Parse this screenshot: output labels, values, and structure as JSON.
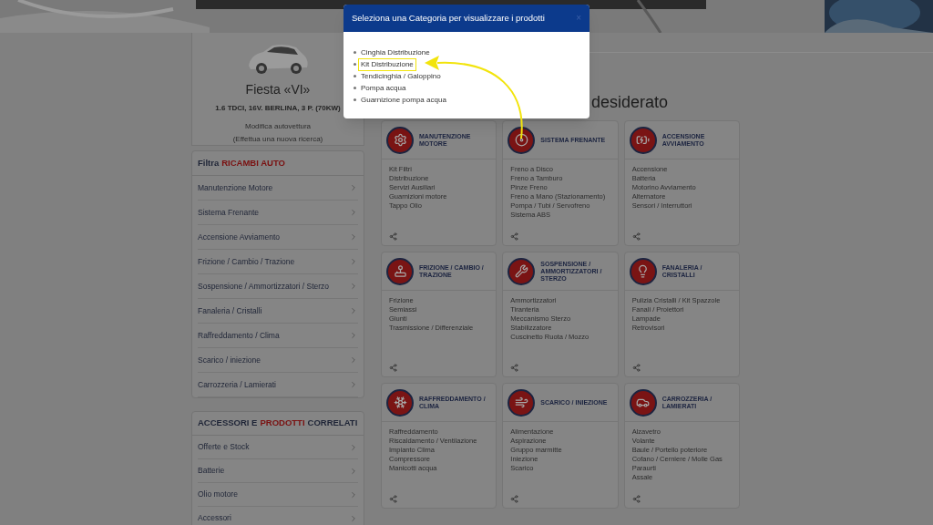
{
  "vehicle": {
    "model": "Fiesta «VI»",
    "version": "1.6 TDCI, 16V. BERLINA, 3 P. (70KW)",
    "edit_link": "Modifica autovettura",
    "new_search_link": "(Effettua una nuova ricerca)"
  },
  "filter": {
    "title": [
      {
        "text": "Filtra",
        "accent": false
      },
      {
        "text": "RICAMBI AUTO",
        "accent": true
      }
    ],
    "items": [
      "Manutenzione Motore",
      "Sistema Frenante",
      "Accensione Avviamento",
      "Frizione / Cambio / Trazione",
      "Sospensione / Ammortizzatori / Sterzo",
      "Fanaleria / Cristalli",
      "Raffreddamento / Clima",
      "Scarico / iniezione",
      "Carrozzeria / Lamierati"
    ]
  },
  "accessories": {
    "title": [
      {
        "text": "ACCESSORI E",
        "accent": false
      },
      {
        "text": "PRODOTTI",
        "accent": true
      },
      {
        "text": "CORRELATI",
        "accent": false
      }
    ],
    "items": [
      "Offerte e Stock",
      "Batterie",
      "Olio motore",
      "Accessori"
    ]
  },
  "main": {
    "heading": "desiderato",
    "categories": [
      {
        "title": "MANUTENZIONE MOTORE",
        "links": [
          "Kit Filtri",
          "Distribuzione",
          "Servizi Ausiliari",
          "Guarnizioni motore",
          "Tappo Olio"
        ]
      },
      {
        "title": "SISTEMA FRENANTE",
        "links": [
          "Freno a Disco",
          "Freno a Tamburo",
          "Pinze Freno",
          "Freno a Mano (Stazionamento)",
          "Pompa / Tubi / Servofreno",
          "Sistema ABS"
        ]
      },
      {
        "title": "ACCENSIONE AVVIAMENTO",
        "links": [
          "Accensione",
          "Batteria",
          "Motorino Avviamento",
          "Alternatore",
          "Sensori / Interruttori"
        ]
      },
      {
        "title": "FRIZIONE / CAMBIO / TRAZIONE",
        "links": [
          "Frizione",
          "Semiassi",
          "Giunti",
          "Trasmissione / Differenziale"
        ]
      },
      {
        "title": "SOSPENSIONE / AMMORTIZZATORI / STERZO",
        "links": [
          "Ammortizzatori",
          "Tiranteria",
          "Meccanismo Sterzo",
          "Stabilizzatore",
          "Cuscinetto Ruota / Mozzo"
        ]
      },
      {
        "title": "FANALERIA / CRISTALLI",
        "links": [
          "Pulizia Cristalli / Kit Spazzole",
          "Fanali / Proiettori",
          "Lampade",
          "Retrovisori"
        ]
      },
      {
        "title": "RAFFREDDAMENTO / CLIMA",
        "links": [
          "Raffreddamento",
          "Riscaldamento / Ventilazione",
          "Impianto Clima",
          "Compressore",
          "Manicotti acqua"
        ]
      },
      {
        "title": "SCARICO / INIEZIONE",
        "links": [
          "Alimentazione",
          "Aspirazione",
          "Gruppo marmitte",
          "Iniezione",
          "Scarico"
        ]
      },
      {
        "title": "CARROZZERIA / LAMIERATI",
        "links": [
          "Alzavetro",
          "Volante",
          "Baule / Portello poteriore",
          "Cofano / Cerniere / Molle Gas",
          "Paraurti",
          "Assale"
        ]
      }
    ]
  },
  "modal": {
    "title": "Seleziona una Categoria per visualizzare i prodotti",
    "close": "×",
    "items": [
      {
        "label": "Cinghia Distribuzione",
        "highlighted": false
      },
      {
        "label": "Kit Distribuzione",
        "highlighted": true
      },
      {
        "label": "Tendicinghia / Galoppino",
        "highlighted": false
      },
      {
        "label": "Pompa acqua",
        "highlighted": false
      },
      {
        "label": "Guarnizione pompa acqua",
        "highlighted": false
      }
    ]
  }
}
